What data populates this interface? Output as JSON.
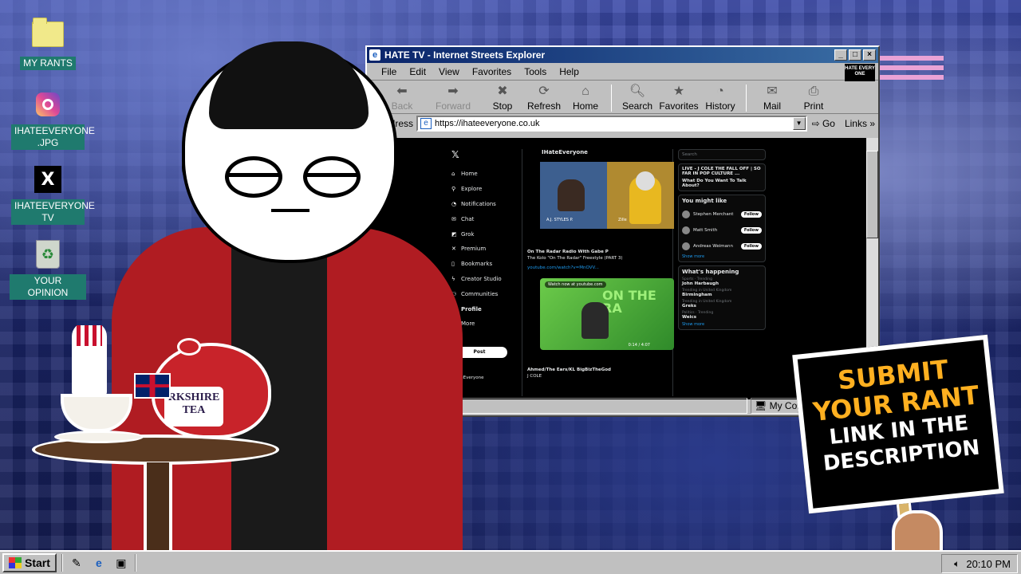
{
  "desktop": {
    "icons": [
      {
        "label": "MY RANTS",
        "icon": "folder-icon"
      },
      {
        "label": "IHATEEVERYONE .JPG",
        "icon": "instagram-icon"
      },
      {
        "label": "IHATEEVERYONE TV",
        "icon": "x-logo-icon"
      },
      {
        "label": "YOUR OPINION",
        "icon": "recycle-bin-icon"
      }
    ]
  },
  "window": {
    "title": "HATE TV - Internet Streets Explorer",
    "menu": [
      "File",
      "Edit",
      "View",
      "Favorites",
      "Tools",
      "Help"
    ],
    "brand_badge": "HATE EVERY ONE",
    "toolbar": {
      "back": "Back",
      "forward": "Forward",
      "stop": "Stop",
      "refresh": "Refresh",
      "home": "Home",
      "search": "Search",
      "favorites": "Favorites",
      "history": "History",
      "mail": "Mail",
      "print": "Print"
    },
    "address_label": "Address",
    "address_value": "https://ihateeveryone.co.uk",
    "go_label": "Go",
    "links_label": "Links",
    "status_zone": "My Computer"
  },
  "x_page": {
    "nav": [
      "Home",
      "Explore",
      "Notifications",
      "Chat",
      "Grok",
      "Premium",
      "Bookmarks",
      "Creator Studio",
      "Communities",
      "Profile",
      "More"
    ],
    "post_button": "Post",
    "profile_name": "IHateEveryone",
    "feed_title": "IHateEveryone",
    "video_a_labels": [
      "A.J. STYLES P.",
      "Zille"
    ],
    "post_b_header": "On The Radar Radio With Gabe P",
    "post_b_text": "The Kolo \"On The Radar\" Freestyle (PART 3)",
    "post_b_link": "youtube.com/watch?v=MnOVV...",
    "post_b_watch": "Watch now at youtube.com",
    "post_b_overlay": "ON THE RA",
    "post_b_time": "0:14 / 4:07",
    "post_c_header": "Ahmed/The Ears/KL BigBizTheGod",
    "post_c_text": "J COLE",
    "search_placeholder": "Search",
    "live_item_1": "LIVE - J COLE THE FALL OFF | SO FAR IN POP CULTURE ...",
    "live_item_2": "What Do You Want To Talk About?",
    "you_might_like": "You might like",
    "suggestions": [
      {
        "name": "Stephen Merchant",
        "handle": "@StephenMerchant",
        "button": "Follow"
      },
      {
        "name": "Matt Smith",
        "handle": "@mattysmith",
        "button": "Follow"
      },
      {
        "name": "Andreas Weimann",
        "handle": "@andiweimann",
        "button": "Follow"
      }
    ],
    "show_more": "Show more",
    "whats_happening": "What's happening",
    "trends": [
      {
        "category": "Sports · Trending",
        "topic": "John Harbaugh"
      },
      {
        "category": "Trending in United Kingdom",
        "topic": "Birmingham"
      },
      {
        "category": "Trending in United Kingdom",
        "topic": "Greks"
      },
      {
        "category": "Politics · Trending",
        "topic": "Weics"
      }
    ]
  },
  "art": {
    "teapot_label": "RKSHIRE TEA",
    "sign_lines": [
      "SUBMIT",
      "YOUR RANT",
      "LINK IN THE",
      "DESCRIPTION"
    ]
  },
  "taskbar": {
    "start_label": "Start",
    "clock": "20:10 PM"
  }
}
